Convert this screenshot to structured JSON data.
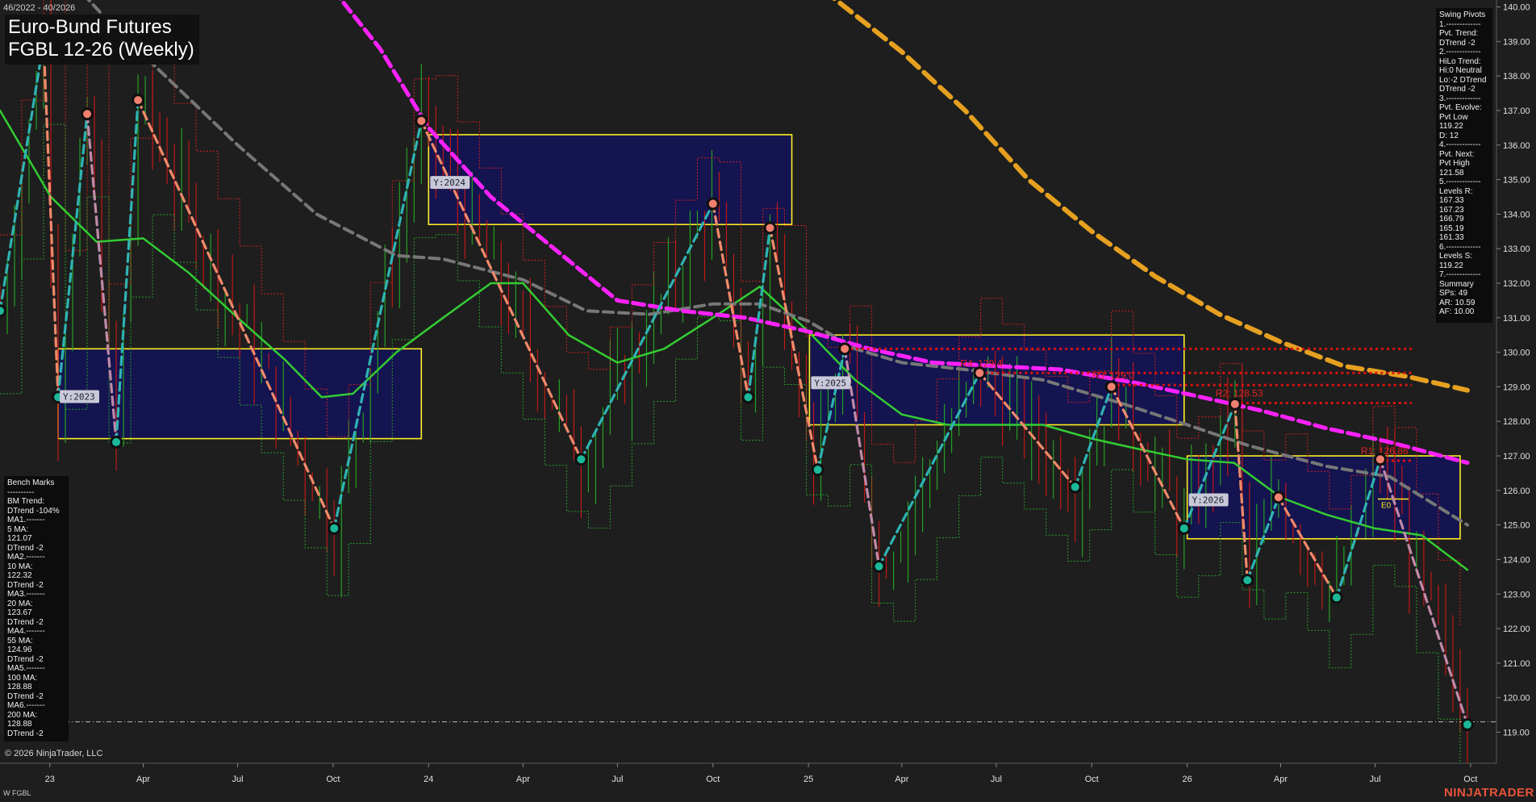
{
  "header": {
    "date_range": "46/2022 - 40/2026",
    "title_line1": "Euro-Bund Futures",
    "title_line2": "FGBL 12-26 (Weekly)"
  },
  "footer": {
    "copyright": "© 2026 NinjaTrader, LLC",
    "symbol": "W FGBL",
    "brand": "NINJATRADER"
  },
  "swing_pivots_panel": {
    "lines": [
      "Swing Pivots",
      "1.-------------",
      "Pvt. Trend:",
      "DTrend -2",
      "2.-------------",
      "HiLo Trend:",
      "Hi:0 Neutral",
      "Lo:-2 DTrend",
      "DTrend -2",
      "3.-------------",
      "Pvt. Evolve:",
      "Pvt Low",
      "119.22",
      "D: 12",
      "4.-------------",
      "Pvt. Next:",
      "Pvt High",
      "121.58",
      "5.-------------",
      "Levels R:",
      "167.33",
      "167.23",
      "166.79",
      "165.19",
      "161.33",
      "6.-------------",
      "Levels S:",
      "119.22",
      "7.-------------",
      "Summary",
      "SPs: 49",
      "AR: 10.59",
      "AF: 10.00"
    ]
  },
  "benchmarks_panel": {
    "lines": [
      "Bench Marks",
      "----------",
      "BM Trend:",
      "DTrend -104%",
      "MA1.-------",
      "5 MA:",
      "121.07",
      "DTrend -2",
      "MA2.-------",
      "10 MA:",
      "122.32",
      "DTrend -2",
      "MA3.-------",
      "20 MA:",
      "123.67",
      "DTrend -2",
      "MA4.-------",
      "55 MA:",
      "124.96",
      "DTrend -2",
      "MA5.-------",
      "100 MA:",
      "128.88",
      "DTrend -2",
      "MA6.-------",
      "200 MA:",
      "128.88",
      "DTrend -2"
    ]
  },
  "colors": {
    "background": "#1e1e1e",
    "axis_text": "#e0e0e0",
    "ma_green": "#33cc33",
    "ma_gray": "#777777",
    "ma_magenta": "#ff22ff",
    "ma_orange": "#e6a020",
    "pivot_up": "#2fb3b3",
    "pivot_down": "#f08a6a",
    "pivot_mid": "#c08aa8",
    "box_fill": "#141450",
    "box_border": "#ffee22",
    "level_red": "#dd1111",
    "bar_red": "#c01818",
    "bar_green": "#25a025"
  },
  "chart_data": {
    "type": "line",
    "title": "FGBL 12-26 (Weekly)",
    "x_axis_labels": [
      "23",
      "Apr",
      "Jul",
      "Oct",
      "24",
      "Apr",
      "Jul",
      "Oct",
      "25",
      "Apr",
      "Jul",
      "Oct",
      "26",
      "Apr",
      "Jul",
      "Oct"
    ],
    "x_axis_dates": [
      "2023-01",
      "2023-04",
      "2023-07",
      "2023-10",
      "2024-01",
      "2024-04",
      "2024-07",
      "2024-10",
      "2025-01",
      "2025-04",
      "2025-07",
      "2025-10",
      "2026-01",
      "2026-04",
      "2026-07",
      "2026-10"
    ],
    "y_ticks": [
      "140.00",
      "139.00",
      "138.00",
      "137.00",
      "136.00",
      "135.00",
      "134.00",
      "133.00",
      "132.00",
      "131.00",
      "130.00",
      "129.00",
      "128.00",
      "127.00",
      "126.00",
      "125.00",
      "124.00",
      "123.00",
      "122.00",
      "121.00",
      "120.00",
      "119.00"
    ],
    "ylim": [
      118.1,
      140.2
    ],
    "xlim": [
      "2022-11-14",
      "2026-10-26"
    ],
    "swing_pivots": [
      {
        "date": "2022-11-14",
        "price": 131.2
      },
      {
        "date": "2022-12-26",
        "price": 139.0
      },
      {
        "date": "2023-01-09",
        "price": 128.7
      },
      {
        "date": "2023-02-06",
        "price": 136.9
      },
      {
        "date": "2023-03-06",
        "price": 127.4
      },
      {
        "date": "2023-03-27",
        "price": 137.3
      },
      {
        "date": "2023-10-02",
        "price": 124.9
      },
      {
        "date": "2023-12-25",
        "price": 136.7
      },
      {
        "date": "2024-05-27",
        "price": 126.9
      },
      {
        "date": "2024-10-01",
        "price": 134.3
      },
      {
        "date": "2024-11-04",
        "price": 128.7
      },
      {
        "date": "2024-11-25",
        "price": 133.6
      },
      {
        "date": "2025-01-10",
        "price": 126.6
      },
      {
        "date": "2025-02-05",
        "price": 130.1
      },
      {
        "date": "2025-03-10",
        "price": 123.8
      },
      {
        "date": "2025-06-15",
        "price": 129.4
      },
      {
        "date": "2025-09-15",
        "price": 126.1
      },
      {
        "date": "2025-10-20",
        "price": 129.0
      },
      {
        "date": "2025-12-29",
        "price": 124.9
      },
      {
        "date": "2026-02-16",
        "price": 128.5
      },
      {
        "date": "2026-02-28",
        "price": 123.4
      },
      {
        "date": "2026-03-30",
        "price": 125.8
      },
      {
        "date": "2026-05-25",
        "price": 122.9
      },
      {
        "date": "2026-07-06",
        "price": 126.9
      },
      {
        "date": "2026-09-28",
        "price": 119.22
      }
    ],
    "yearly_boxes": [
      {
        "label": "Y:2023",
        "start": "2023-01-09",
        "end": "2023-12-25",
        "high": 130.1,
        "low": 127.5
      },
      {
        "label": "Y:2024",
        "start": "2024-01-01",
        "end": "2024-12-16",
        "high": 136.3,
        "low": 133.7
      },
      {
        "label": "Y:2025",
        "start": "2025-01-02",
        "end": "2025-12-29",
        "high": 130.5,
        "low": 127.9
      },
      {
        "label": "Y:2026",
        "start": "2026-01-01",
        "end": "2026-09-21",
        "high": 127.0,
        "low": 124.6
      }
    ],
    "resistance_levels": [
      {
        "label": "",
        "price": 130.1,
        "start": "2025-02-05"
      },
      {
        "label": "R4: 129.4",
        "price": 129.4,
        "start": "2025-06-15"
      },
      {
        "label": "R3: 129.0",
        "price": 129.05,
        "start": "2025-10-20"
      },
      {
        "label": "R2: 128.53",
        "price": 128.53,
        "start": "2026-02-16"
      },
      {
        "label": "R1: 126.86",
        "price": 126.86,
        "start": "2026-07-06"
      }
    ],
    "current_price": 119.3,
    "e0_label": "E0",
    "e0_price": 125.75,
    "series": [
      {
        "key": "ma_green",
        "points": [
          [
            "2022-11-14",
            137.0
          ],
          [
            "2023-01-02",
            134.5
          ],
          [
            "2023-02-15",
            133.2
          ],
          [
            "2023-04-01",
            133.3
          ],
          [
            "2023-05-15",
            132.3
          ],
          [
            "2023-07-01",
            131.0
          ],
          [
            "2023-08-15",
            129.8
          ],
          [
            "2023-09-20",
            128.7
          ],
          [
            "2023-10-20",
            128.8
          ],
          [
            "2023-12-01",
            130.0
          ],
          [
            "2024-01-15",
            131.0
          ],
          [
            "2024-03-01",
            132.0
          ],
          [
            "2024-04-01",
            132.0
          ],
          [
            "2024-05-15",
            130.5
          ],
          [
            "2024-07-01",
            129.7
          ],
          [
            "2024-08-15",
            130.1
          ],
          [
            "2024-10-01",
            131.0
          ],
          [
            "2024-11-15",
            131.9
          ],
          [
            "2025-01-01",
            130.6
          ],
          [
            "2025-02-15",
            129.2
          ],
          [
            "2025-04-01",
            128.2
          ],
          [
            "2025-05-15",
            127.9
          ],
          [
            "2025-07-01",
            127.9
          ],
          [
            "2025-08-15",
            127.9
          ],
          [
            "2025-10-01",
            127.5
          ],
          [
            "2025-11-15",
            127.2
          ],
          [
            "2026-01-01",
            126.9
          ],
          [
            "2026-02-15",
            126.8
          ],
          [
            "2026-04-01",
            125.8
          ],
          [
            "2026-05-15",
            125.3
          ],
          [
            "2026-07-01",
            124.9
          ],
          [
            "2026-08-15",
            124.7
          ],
          [
            "2026-09-28",
            123.7
          ]
        ]
      },
      {
        "key": "ma_gray",
        "points": [
          [
            "2022-11-14",
            143.0
          ],
          [
            "2023-03-01",
            139.5
          ],
          [
            "2023-07-01",
            136.0
          ],
          [
            "2023-09-15",
            134.0
          ],
          [
            "2023-12-01",
            132.8
          ],
          [
            "2024-01-15",
            132.7
          ],
          [
            "2024-04-01",
            132.1
          ],
          [
            "2024-06-01",
            131.2
          ],
          [
            "2024-08-01",
            131.1
          ],
          [
            "2024-10-01",
            131.4
          ],
          [
            "2024-11-15",
            131.4
          ],
          [
            "2025-01-01",
            130.9
          ],
          [
            "2025-02-15",
            130.1
          ],
          [
            "2025-04-01",
            129.7
          ],
          [
            "2025-06-01",
            129.5
          ],
          [
            "2025-08-15",
            129.2
          ],
          [
            "2025-11-01",
            128.5
          ],
          [
            "2026-01-01",
            127.9
          ],
          [
            "2026-03-01",
            127.3
          ],
          [
            "2026-05-15",
            126.7
          ],
          [
            "2026-07-15",
            126.4
          ],
          [
            "2026-09-28",
            125.0
          ]
        ]
      },
      {
        "key": "ma_magenta",
        "points": [
          [
            "2023-10-01",
            140.5
          ],
          [
            "2023-11-15",
            138.8
          ],
          [
            "2024-01-01",
            136.5
          ],
          [
            "2024-03-01",
            134.5
          ],
          [
            "2024-05-01",
            133.0
          ],
          [
            "2024-07-01",
            131.5
          ],
          [
            "2024-09-01",
            131.2
          ],
          [
            "2024-11-01",
            131.0
          ],
          [
            "2025-01-01",
            130.6
          ],
          [
            "2025-03-01",
            130.1
          ],
          [
            "2025-05-01",
            129.7
          ],
          [
            "2025-07-01",
            129.6
          ],
          [
            "2025-09-01",
            129.5
          ],
          [
            "2025-11-15",
            129.1
          ],
          [
            "2026-01-15",
            128.7
          ],
          [
            "2026-03-15",
            128.3
          ],
          [
            "2026-05-15",
            127.8
          ],
          [
            "2026-07-15",
            127.4
          ],
          [
            "2026-09-28",
            126.8
          ]
        ]
      },
      {
        "key": "ma_orange",
        "points": [
          [
            "2025-01-15",
            140.5
          ],
          [
            "2025-04-01",
            138.7
          ],
          [
            "2025-06-01",
            137.0
          ],
          [
            "2025-08-01",
            135.0
          ],
          [
            "2025-10-01",
            133.5
          ],
          [
            "2025-12-01",
            132.2
          ],
          [
            "2026-02-01",
            131.1
          ],
          [
            "2026-04-01",
            130.3
          ],
          [
            "2026-06-01",
            129.6
          ],
          [
            "2026-08-01",
            129.3
          ],
          [
            "2026-09-28",
            128.9
          ]
        ]
      }
    ]
  }
}
